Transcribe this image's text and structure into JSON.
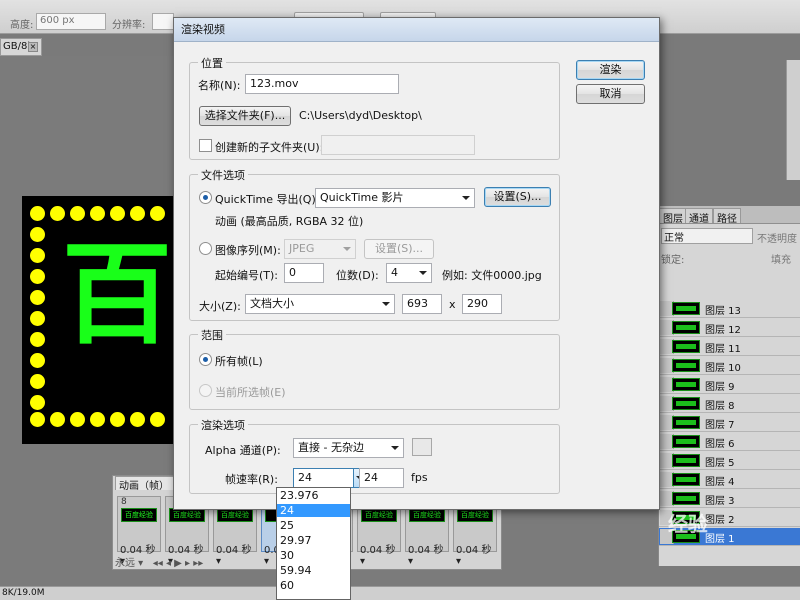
{
  "background": {
    "options_bar": {
      "height_label": "高度:",
      "height_value": "600 px",
      "resolution_label": "分辨率:"
    },
    "doc_tab": {
      "label": "GB/8)",
      "close": "×"
    },
    "canvas_char": "百",
    "status": "8K/19.0M",
    "animation_panel": {
      "tab_label": "动画（帧）",
      "frames": [
        {
          "num": "8",
          "thumb": "百度经验",
          "duration": "0.04 秒▾"
        },
        {
          "num": "",
          "thumb": "百度经验",
          "duration": "0.04 秒▾"
        },
        {
          "num": "",
          "thumb": "百度经验",
          "duration": "0.04 秒▾"
        },
        {
          "num": "",
          "thumb": "",
          "duration": "0.04 秒▾"
        },
        {
          "num": "",
          "thumb": "百度经验",
          "duration": "0.04 秒▾"
        },
        {
          "num": "",
          "thumb": "百度经验",
          "duration": "0.04 秒▾"
        },
        {
          "num": "",
          "thumb": "百度经验",
          "duration": "0.04 秒▾"
        },
        {
          "num": "",
          "thumb": "百度经验",
          "duration": "0.04 秒▾"
        }
      ],
      "loop": "永远"
    },
    "layers_panel": {
      "tabs": [
        "图层",
        "通道",
        "路径"
      ],
      "blend_mode": "正常",
      "opacity_label": "不透明度",
      "lock_label": "锁定:",
      "fill_label": "填充",
      "layers": [
        "图层 13",
        "图层 12",
        "图层 11",
        "图层 10",
        "图层 9",
        "图层 8",
        "图层 7",
        "图层 6",
        "图层 5",
        "图层 4",
        "图层 3",
        "图层 2",
        "图层 1"
      ],
      "active_layer": "图层 1"
    },
    "watermark": "经验"
  },
  "dialog": {
    "title": "渲染视频",
    "ok_label": "渲染",
    "cancel_label": "取消",
    "location": {
      "title": "位置",
      "name_label": "名称(N):",
      "name_value": "123.mov",
      "choose_folder_label": "选择文件夹(F)...",
      "folder_path": "C:\\Users\\dyd\\Desktop\\",
      "new_subfolder_label": "创建新的子文件夹(U):",
      "new_subfolder_value": ""
    },
    "file_options": {
      "title": "文件选项",
      "quicktime_label": "QuickTime 导出(Q):",
      "quicktime_format": "QuickTime 影片",
      "settings_label": "设置(S)...",
      "quicktime_desc": "动画 (最高品质, RGBA 32 位)",
      "image_seq_label": "图像序列(M):",
      "image_seq_format": "JPEG",
      "image_seq_settings_label": "设置(S)...",
      "start_number_label": "起始编号(T):",
      "start_number_value": "0",
      "digits_label": "位数(D):",
      "digits_value": "4",
      "example_label": "例如: 文件0000.jpg",
      "size_label": "大小(Z):",
      "size_value": "文档大小",
      "width_value": "693",
      "x_label": "x",
      "height_value": "290"
    },
    "range": {
      "title": "范围",
      "all_frames_label": "所有帧(L)",
      "current_frames_label": "当前所选帧(E)"
    },
    "render_options": {
      "title": "渲染选项",
      "alpha_label": "Alpha 通道(P):",
      "alpha_value": "直接 - 无杂边",
      "fps_label": "帧速率(R):",
      "fps_select_value": "24",
      "fps_input_value": "24",
      "fps_unit": "fps"
    }
  },
  "fps_dropdown": {
    "options": [
      "23.976",
      "24",
      "25",
      "29.97",
      "30",
      "59.94",
      "60"
    ],
    "selected": "24"
  }
}
